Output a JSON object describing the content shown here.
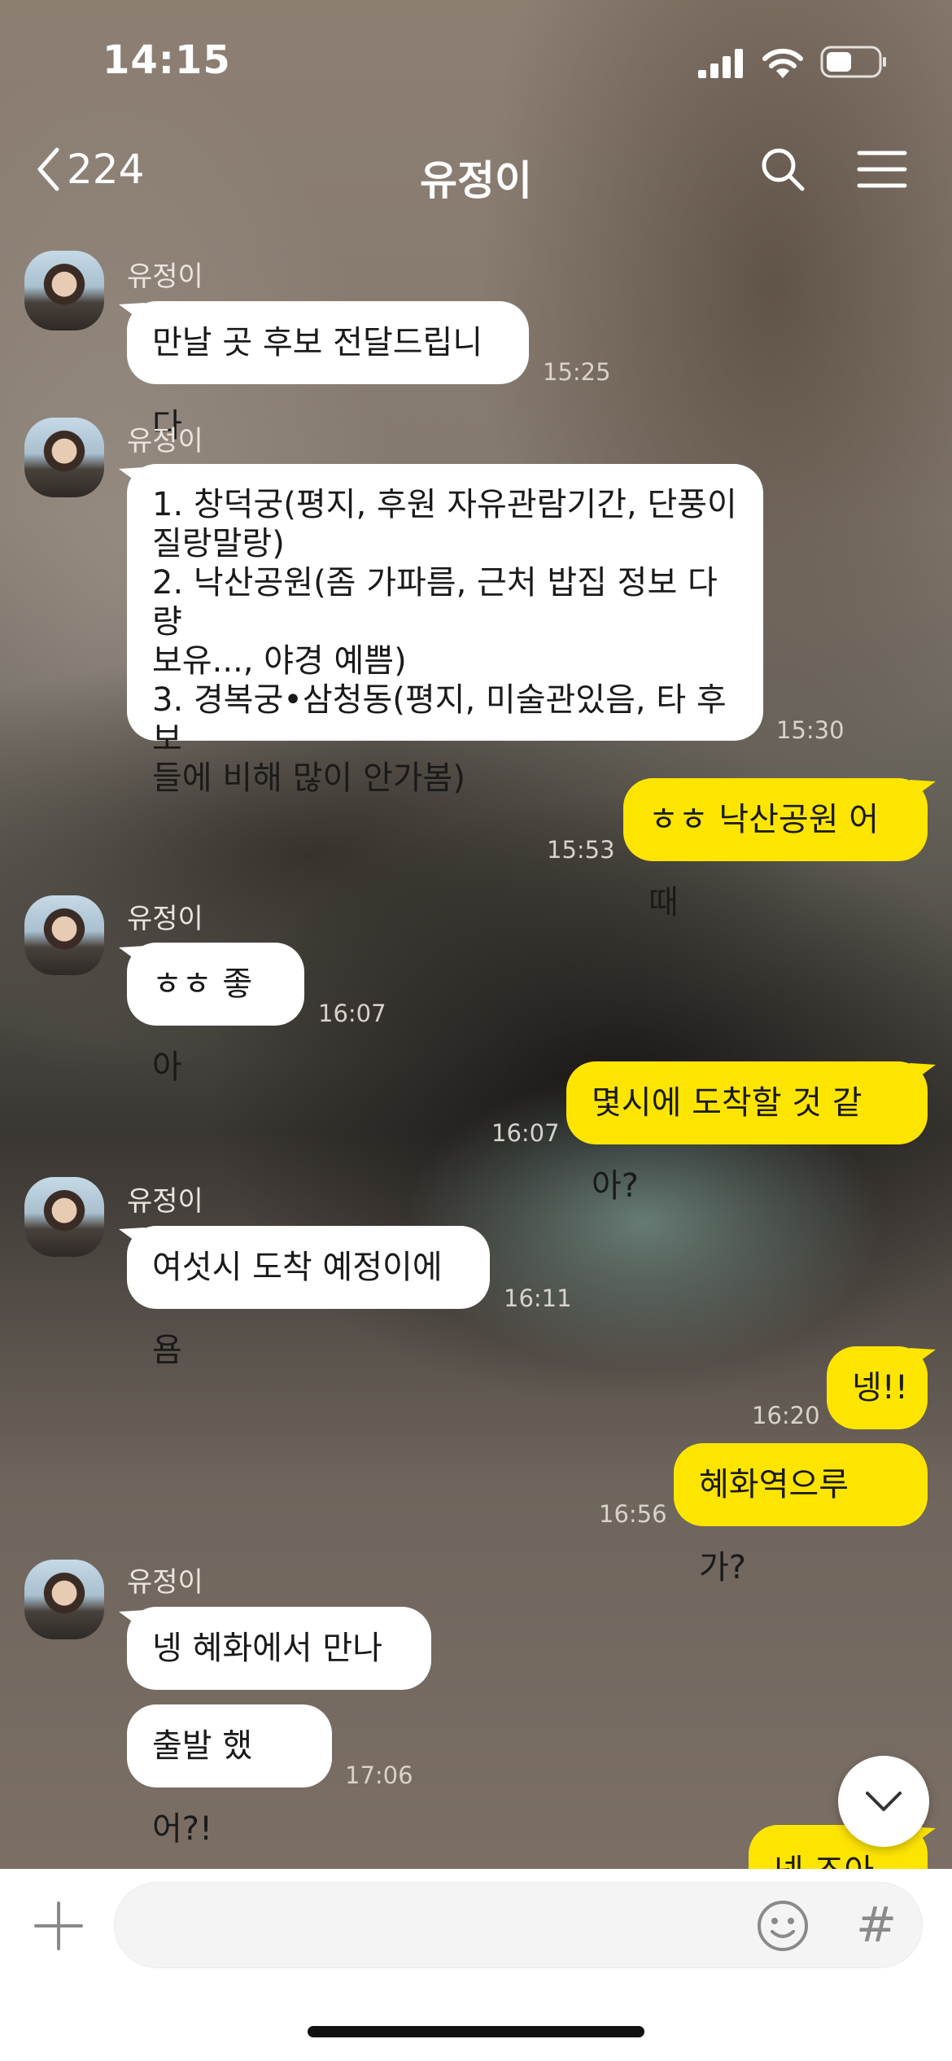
{
  "status_bar": {
    "time": "14:15"
  },
  "nav": {
    "back_count": "224",
    "title": "유정이"
  },
  "messages": [
    {
      "sender": "유정이",
      "text": "만날 곳 후보 전달드립니다",
      "time": "15:25"
    },
    {
      "sender": "유정이",
      "text": "1. 창덕궁(평지, 후원 자유관람기간, 단풍이\n질랑말랑)\n2. 낙산공원(좀 가파름, 근처 밥집 정보 다량\n보유..., 야경 예쁨)\n3. 경복궁•삼청동(평지, 미술관있음, 타 후보\n들에 비해 많이 안가봄)",
      "time": "15:30"
    },
    {
      "text": "ㅎㅎ 낙산공원 어때",
      "time": "15:53"
    },
    {
      "sender": "유정이",
      "text": "ㅎㅎ 좋아",
      "time": "16:07"
    },
    {
      "text": "몇시에 도착할 것 같아?",
      "time": "16:07"
    },
    {
      "sender": "유정이",
      "text": "여섯시 도착 예정이에욤",
      "time": "16:11"
    },
    {
      "text": "넹!!",
      "time": "16:20"
    },
    {
      "text": "혜화역으루 가?",
      "time": "16:56"
    },
    {
      "sender": "유정이",
      "text": "넹 혜화에서 만나욤"
    },
    {
      "text": "출발 했어?!",
      "time": "17:06"
    },
    {
      "text": "넹 조아욤"
    }
  ],
  "input": {
    "placeholder": ""
  },
  "colors": {
    "outgoing_bubble": "#fee500",
    "incoming_bubble": "#ffffff"
  },
  "icons": [
    "back-chevron-icon",
    "search-icon",
    "menu-icon",
    "plus-icon",
    "emoji-icon",
    "hashtag-icon",
    "chevron-down-icon",
    "signal-icon",
    "wifi-icon",
    "battery-icon"
  ]
}
